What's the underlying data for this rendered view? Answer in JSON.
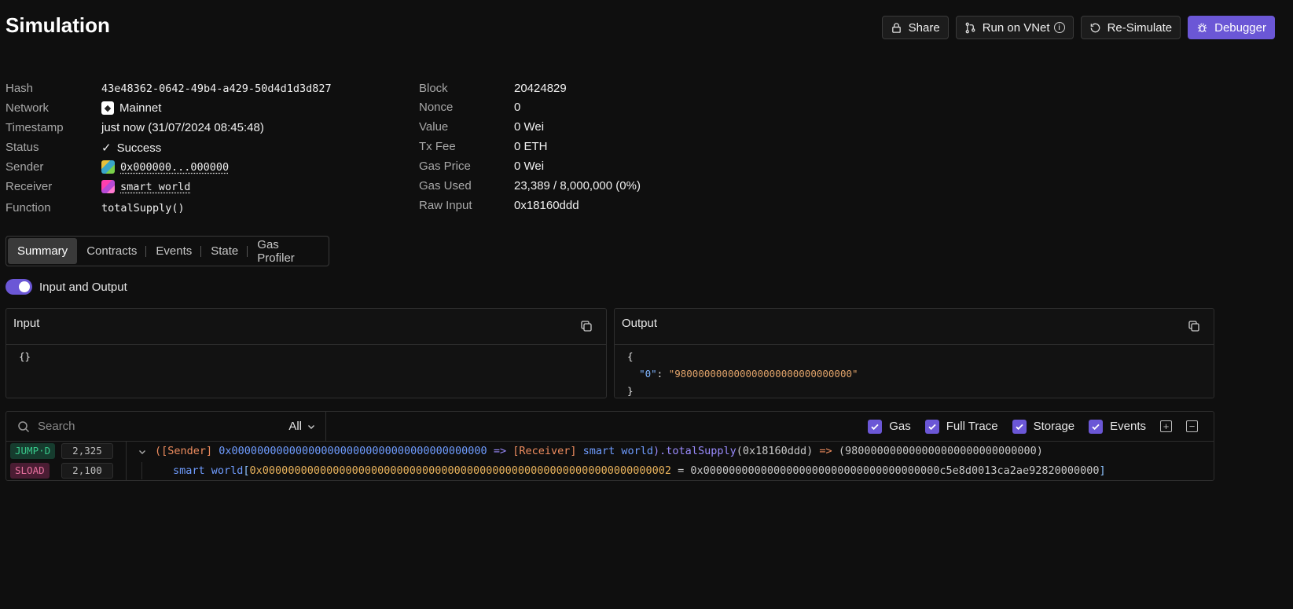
{
  "header": {
    "title": "Simulation",
    "buttons": {
      "share": "Share",
      "run_vnet": "Run on VNet",
      "resimulate": "Re-Simulate",
      "debugger": "Debugger"
    }
  },
  "details_left": [
    {
      "label": "Hash",
      "value": "43e48362-0642-49b4-a429-50d4d1d3d827"
    },
    {
      "label": "Network",
      "value": "Mainnet"
    },
    {
      "label": "Timestamp",
      "value": "just now (31/07/2024 08:45:48)"
    },
    {
      "label": "Status",
      "value": "Success"
    },
    {
      "label": "Sender",
      "value": "0x000000...000000"
    },
    {
      "label": "Receiver",
      "value": "smart world"
    },
    {
      "label": "Function",
      "value": "totalSupply()"
    }
  ],
  "details_right": [
    {
      "label": "Block",
      "value": "20424829"
    },
    {
      "label": "Nonce",
      "value": "0"
    },
    {
      "label": "Value",
      "value": "0 Wei"
    },
    {
      "label": "Tx Fee",
      "value": "0 ETH"
    },
    {
      "label": "Gas Price",
      "value": "0 Wei"
    },
    {
      "label": "Gas Used",
      "value": "23,389 / 8,000,000 (0%)"
    },
    {
      "label": "Raw Input",
      "value": "0x18160ddd"
    }
  ],
  "tabs": [
    "Summary",
    "Contracts",
    "Events",
    "State",
    "Gas Profiler"
  ],
  "active_tab": "Summary",
  "toggle": {
    "label": "Input and Output",
    "on": true
  },
  "input_panel": {
    "title": "Input",
    "body": "{}"
  },
  "output_panel": {
    "title": "Output",
    "open": "{",
    "key": "\"0\"",
    "colon": ": ",
    "value": "\"980000000000000000000000000000\"",
    "close": "}"
  },
  "trace_toolbar": {
    "search_placeholder": "Search",
    "filter": "All",
    "checks": [
      "Gas",
      "Full Trace",
      "Storage",
      "Events"
    ]
  },
  "trace": [
    {
      "op": "JUMP·D",
      "gas": "2,325",
      "sender_tag": "([Sender]",
      "sender_addr": "0x0000000000000000000000000000000000000000",
      "arrow": "=>",
      "receiver_tag": "[Receiver]",
      "receiver_name": "smart world",
      "call": ").totalSupply",
      "args": "(0x18160ddd)",
      "arrow2": "=>",
      "result": "(980000000000000000000000000000)"
    },
    {
      "op": "SLOAD",
      "gas": "2,100",
      "contract": "smart world",
      "bracket_open": "[",
      "slot": "0x0000000000000000000000000000000000000000000000000000000000000002",
      "eq": " = ",
      "value": "0x0000000000000000000000000000000000000c5e8d0013ca2ae92820000000",
      "bracket_close": "]"
    }
  ],
  "colors": {
    "accent": "#6b57d6",
    "success": "#3fb26a",
    "background": "#0f0f0f"
  }
}
